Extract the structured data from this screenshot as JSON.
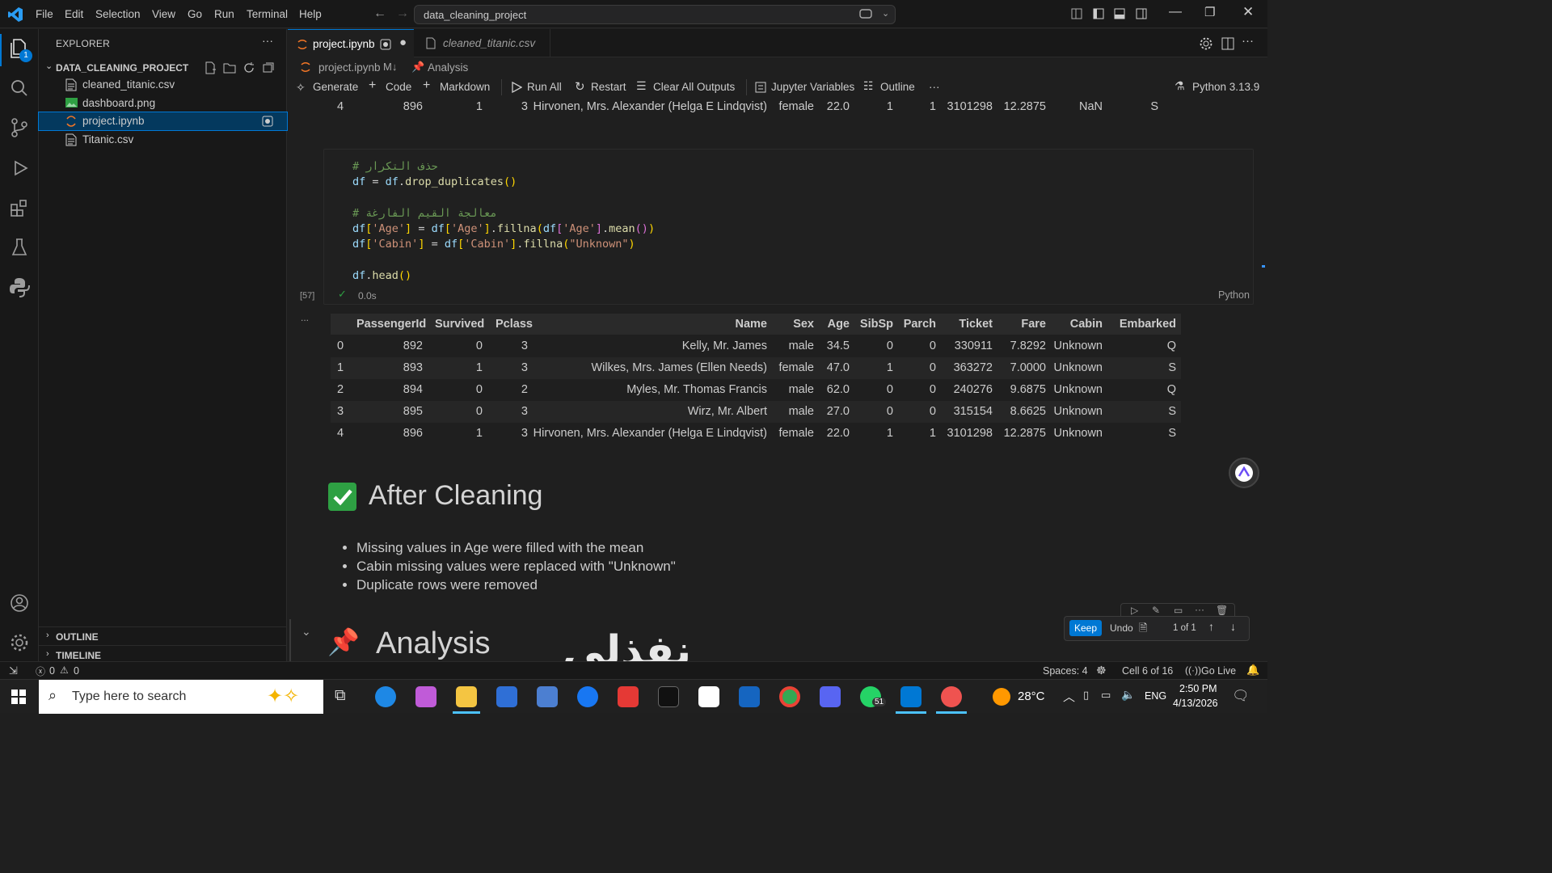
{
  "menu": [
    "File",
    "Edit",
    "Selection",
    "View",
    "Go",
    "Run",
    "Terminal",
    "Help"
  ],
  "command_center": "data_cleaning_project",
  "explorer": {
    "title": "EXPLORER",
    "folder": "DATA_CLEANING_PROJECT",
    "files": [
      "cleaned_titanic.csv",
      "dashboard.png",
      "project.ipynb",
      "Titanic.csv"
    ],
    "outline": "OUTLINE",
    "timeline": "TIMELINE",
    "badge": "1"
  },
  "tabs": [
    {
      "label": "project.ipynb"
    },
    {
      "label": "cleaned_titanic.csv"
    }
  ],
  "breadcrumb": {
    "file": "project.ipynb",
    "sep": "M↓",
    "section": "Analysis"
  },
  "toolbar": {
    "generate": "Generate",
    "code": "Code",
    "markdown": "Markdown",
    "run_all": "Run All",
    "restart": "Restart",
    "clear": "Clear All Outputs",
    "variables": "Jupyter Variables",
    "outline": "Outline",
    "more": "···",
    "kernel": "Python 3.13.9"
  },
  "prev_row": [
    "4",
    "896",
    "1",
    "3",
    "Hirvonen, Mrs. Alexander (Helga E Lindqvist)",
    "female",
    "22.0",
    "1",
    "1",
    "3101298",
    "12.2875",
    "NaN",
    "S"
  ],
  "cell": {
    "lines": [
      "# حذف التكرار",
      "df = df.drop_duplicates()",
      "",
      "# معالجة القيم الفارغة",
      "df['Age'] = df['Age'].fillna(df['Age'].mean())",
      "df['Cabin'] = df['Cabin'].fillna(\"Unknown\")",
      "",
      "df.head()"
    ],
    "exec_count": "[57]",
    "time": "0.0s",
    "lang": "Python",
    "more": "..."
  },
  "table": {
    "headers": [
      "",
      "PassengerId",
      "Survived",
      "Pclass",
      "Name",
      "Sex",
      "Age",
      "SibSp",
      "Parch",
      "Ticket",
      "Fare",
      "Cabin",
      "Embarked"
    ],
    "rows": [
      [
        "0",
        "892",
        "0",
        "3",
        "Kelly, Mr. James",
        "male",
        "34.5",
        "0",
        "0",
        "330911",
        "7.8292",
        "Unknown",
        "Q"
      ],
      [
        "1",
        "893",
        "1",
        "3",
        "Wilkes, Mrs. James (Ellen Needs)",
        "female",
        "47.0",
        "1",
        "0",
        "363272",
        "7.0000",
        "Unknown",
        "S"
      ],
      [
        "2",
        "894",
        "0",
        "2",
        "Myles, Mr. Thomas Francis",
        "male",
        "62.0",
        "0",
        "0",
        "240276",
        "9.6875",
        "Unknown",
        "Q"
      ],
      [
        "3",
        "895",
        "0",
        "3",
        "Wirz, Mr. Albert",
        "male",
        "27.0",
        "0",
        "0",
        "315154",
        "8.6625",
        "Unknown",
        "S"
      ],
      [
        "4",
        "896",
        "1",
        "3",
        "Hirvonen, Mrs. Alexander (Helga E Lindqvist)",
        "female",
        "22.0",
        "1",
        "1",
        "3101298",
        "12.2875",
        "Unknown",
        "S"
      ]
    ]
  },
  "markdown": {
    "heading": "After Cleaning",
    "bullets": [
      "Missing values in Age were filled with the mean",
      "Cabin missing values were replaced with \"Unknown\"",
      "Duplicate rows were removed"
    ],
    "heading2": "Analysis"
  },
  "chat_edit": {
    "keep": "Keep",
    "undo": "Undo",
    "count": "1 of 1"
  },
  "watermark": "نفذلى",
  "status": {
    "errors": "0",
    "warnings": "0",
    "spaces": "Spaces: 4",
    "cell": "Cell 6 of 16",
    "live": "Go Live"
  },
  "taskbar": {
    "search_placeholder": "Type here to search",
    "temp": "28°C",
    "lang": "ENG",
    "time": "2:50 PM",
    "date": "4/13/2026",
    "whatsapp_badge": "51"
  },
  "colors": {
    "accent": "#0078d4",
    "keep": "#0078d4",
    "check": "#2ea043"
  }
}
